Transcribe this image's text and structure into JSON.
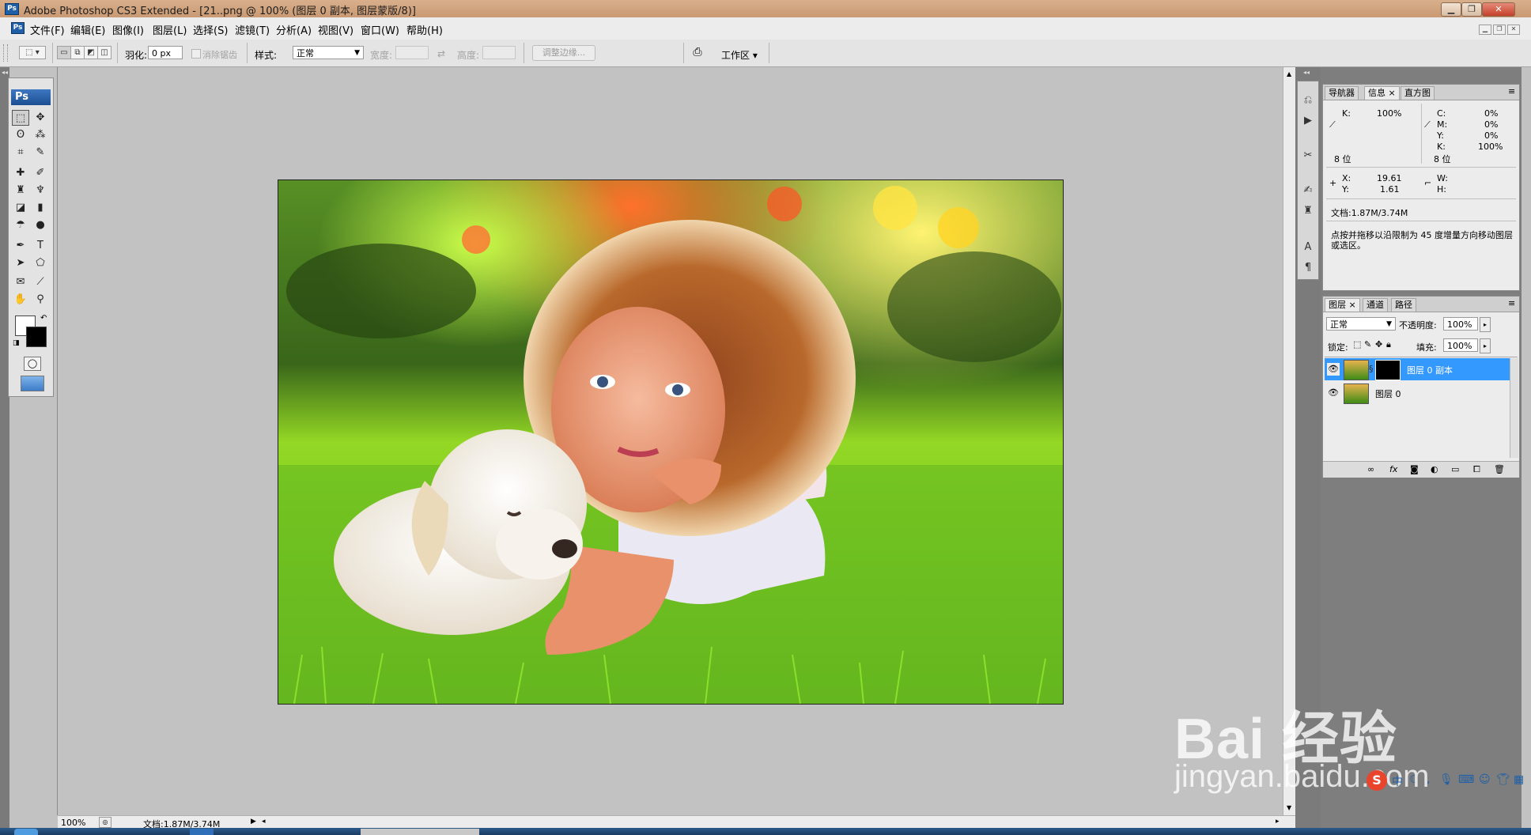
{
  "window": {
    "app_icon": "Ps",
    "title": "Adobe Photoshop CS3 Extended - [21..png @ 100% (图层 0 副本, 图层蒙版/8)]",
    "controls": [
      "minimize-icon",
      "restore-icon",
      "close-icon"
    ]
  },
  "menubar": {
    "items": [
      "文件(F)",
      "编辑(E)",
      "图像(I)",
      "图层(L)",
      "选择(S)",
      "滤镜(T)",
      "分析(A)",
      "视图(V)",
      "窗口(W)",
      "帮助(H)"
    ]
  },
  "options": {
    "feather_label": "羽化:",
    "feather_value": "0 px",
    "antialias_label": "消除锯齿",
    "style_label": "样式:",
    "style_value": "正常",
    "width_label": "宽度:",
    "height_label": "高度:",
    "refine_edge": "调整边缘...",
    "workspace": "工作区 ▾"
  },
  "toolbox": {
    "header": "Ps"
  },
  "statusbar": {
    "zoom": "100%",
    "doc": "文档:1.87M/3.74M"
  },
  "info_panel": {
    "tabs": [
      "导航器",
      "信息",
      "直方图"
    ],
    "active_tab": "信息",
    "k_left_label": "K:",
    "k_left_value": "100%",
    "bits_left": "8 位",
    "c_label": "C:",
    "c_value": "0%",
    "m_label": "M:",
    "m_value": "0%",
    "y_label": "Y:",
    "y_value": "0%",
    "k_label": "K:",
    "k_value": "100%",
    "bits_right": "8 位",
    "x_label": "X:",
    "x_value": "19.61",
    "ypos_label": "Y:",
    "ypos_value": "1.61",
    "w_label": "W:",
    "h_label": "H:",
    "doc": "文档:1.87M/3.74M",
    "hint": "点按并拖移以沿限制为 45 度增量方向移动图层或选区。"
  },
  "layers_panel": {
    "tabs": [
      "图层",
      "通道",
      "路径"
    ],
    "active_tab": "图层",
    "blend_mode": "正常",
    "opacity_label": "不透明度:",
    "opacity_value": "100%",
    "lock_label": "锁定:",
    "fill_label": "填充:",
    "fill_value": "100%",
    "layers": [
      {
        "name": "图层 0 副本",
        "selected": true,
        "visible": true,
        "has_mask": true
      },
      {
        "name": "图层 0",
        "selected": false,
        "visible": true,
        "has_mask": false
      }
    ],
    "footer_icons": [
      "link-layers-icon",
      "fx-icon",
      "mask-icon",
      "adjustment-icon",
      "group-icon",
      "new-layer-icon",
      "trash-icon"
    ]
  },
  "watermark": {
    "line1": "Bai 经验",
    "line2": "jingyan.baidu.com"
  },
  "colors": {
    "selection_blue": "#3399ff",
    "title_bar": "#c99a73",
    "canvas_bg": "#c2c2c2"
  }
}
